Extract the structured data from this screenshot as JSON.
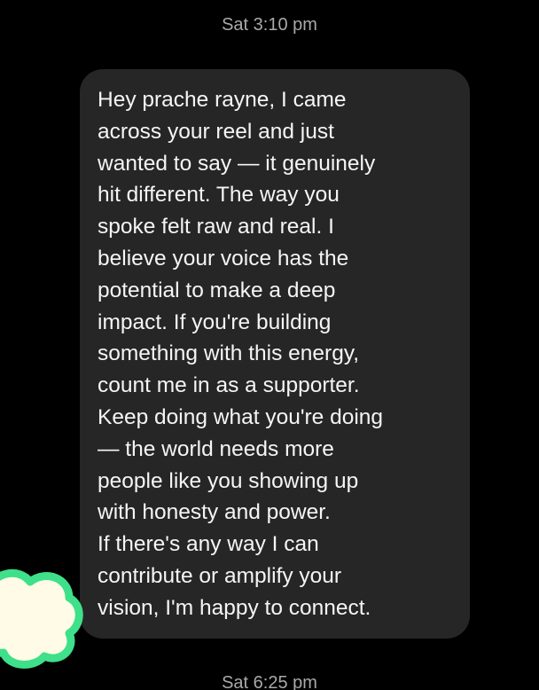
{
  "thread": {
    "timestamp_top": "Sat 3:10 pm",
    "timestamp_bottom": "Sat 6:25 pm"
  },
  "message": {
    "text": "Hey prache rayne, I came\nacross your reel and just\nwanted to say — it genuinely\nhit different. The way you\nspoke felt raw and real. I\nbelieve your voice has the\npotential to make a deep\nimpact. If you're building\nsomething with this energy,\ncount me in as a supporter.\nKeep doing what you're doing\n— the world needs more\npeople like you showing up\nwith honesty and power.\nIf there's any way I can\ncontribute or amplify your\nvision, I'm happy to connect."
  },
  "colors": {
    "background": "#000000",
    "bubble": "#262626",
    "text": "#f5f5f5",
    "timestamp": "#a9a9a9",
    "sticker_outline": "#3ee08a",
    "sticker_fill": "#fffbe6"
  },
  "icons": {
    "sticker": "cloud-sticker-icon"
  }
}
